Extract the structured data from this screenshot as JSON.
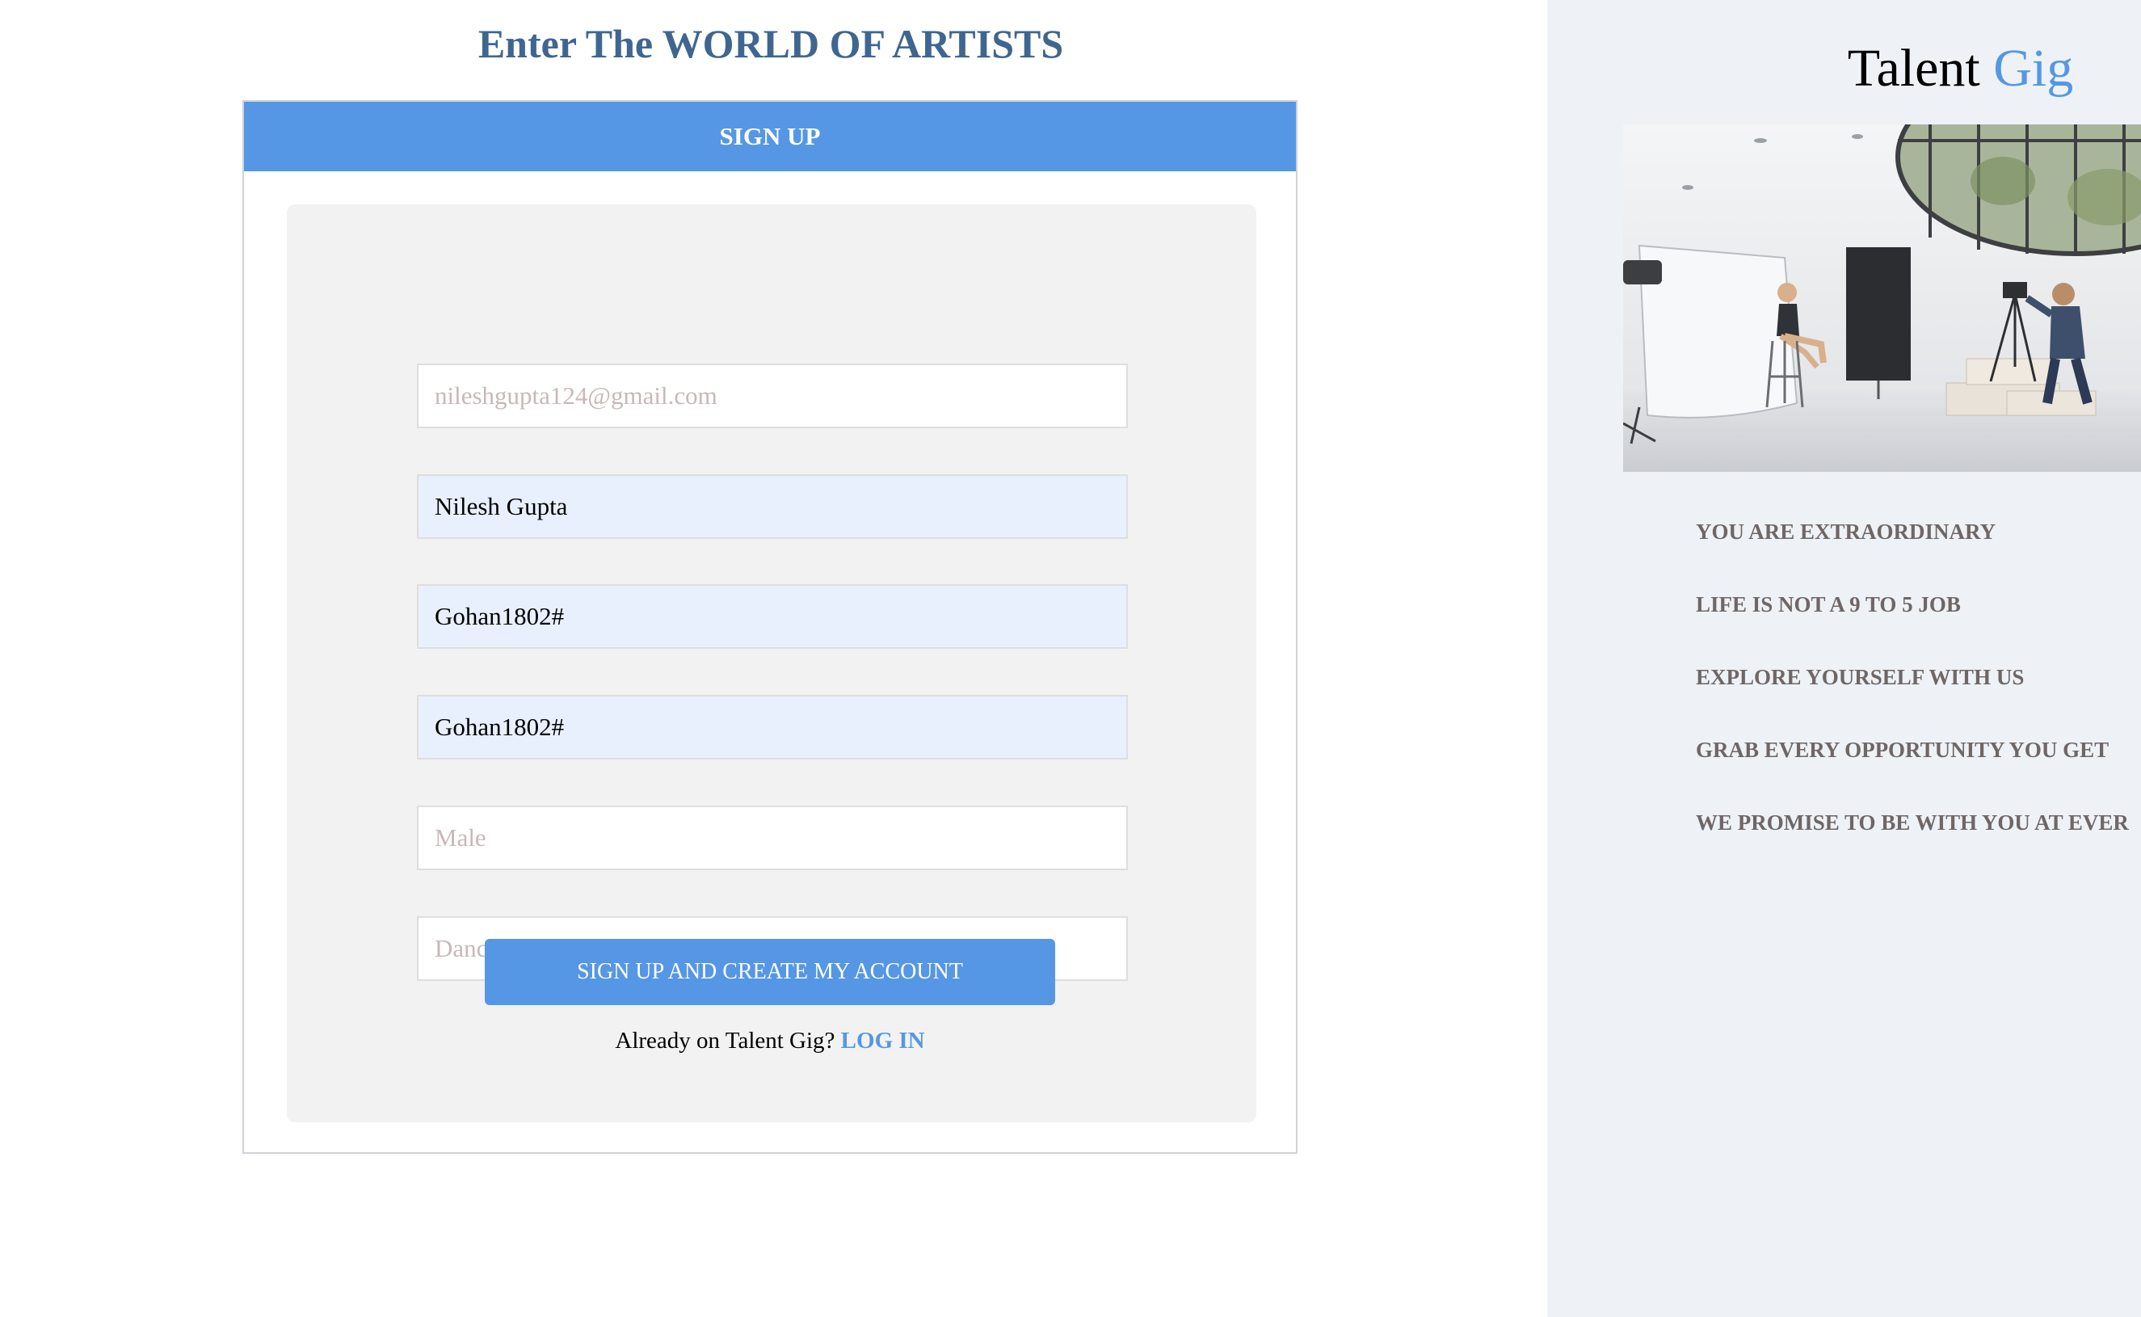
{
  "page_title": "Enter The WORLD OF ARTISTS",
  "signup": {
    "header": "SIGN UP",
    "fields": {
      "email_placeholder": "nileshgupta124@gmail.com",
      "name_value": "Nilesh Gupta",
      "password_value": "Gohan1802#",
      "confirm_password_value": "Gohan1802#",
      "gender_placeholder": "Male",
      "talent_placeholder": "Dancing"
    },
    "submit_label": "SIGN UP AND CREATE MY ACCOUNT",
    "login_prompt": "Already on Talent Gig?",
    "login_link": "LOG IN"
  },
  "sidebar": {
    "brand_part1": "Talent",
    "brand_part2": "Gig",
    "taglines": [
      "YOU ARE EXTRAORDINARY",
      "LIFE IS NOT A 9 TO 5 JOB",
      "EXPLORE YOURSELF WITH US",
      "GRAB EVERY OPPORTUNITY YOU GET",
      "WE PROMISE TO BE WITH YOU AT EVER"
    ]
  },
  "colors": {
    "accent": "#5597e4",
    "title": "#3f6690",
    "sidebar_bg": "#eef2f6",
    "tagline": "#6f6666",
    "autofill": "#e8f0fd"
  }
}
